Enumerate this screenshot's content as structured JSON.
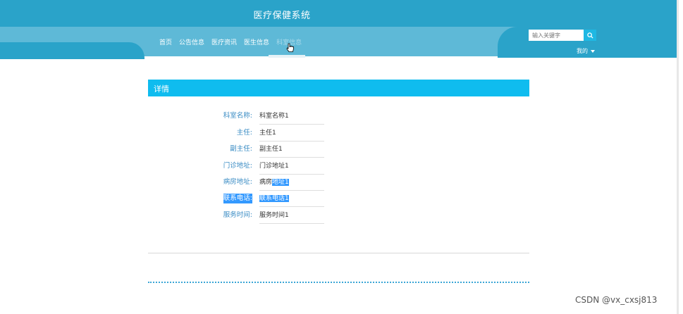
{
  "app": {
    "title": "医疗保健系统"
  },
  "nav": {
    "items": [
      {
        "label": "首页",
        "dim": false
      },
      {
        "label": "公告信息",
        "dim": false
      },
      {
        "label": "医疗资讯",
        "dim": false
      },
      {
        "label": "医生信息",
        "dim": false
      },
      {
        "label": "科室信息",
        "dim": true
      }
    ]
  },
  "search": {
    "placeholder": "输入关键字",
    "icon": "search-icon"
  },
  "user": {
    "label": "我的",
    "icon": "caret-down-icon"
  },
  "card": {
    "title": "详情"
  },
  "detail": {
    "fields": [
      {
        "label": "科室名称:",
        "value": "科室名称1"
      },
      {
        "label": "主任:",
        "value": "主任1"
      },
      {
        "label": "副主任:",
        "value": "副主任1"
      },
      {
        "label": "门诊地址:",
        "value": "门诊地址1"
      },
      {
        "label": "病房地址:",
        "value_plain": "病房",
        "value_selected": "地址1"
      },
      {
        "label": "联系电话:",
        "value": "联系电话1"
      },
      {
        "label": "服务时间:",
        "value": "服务时间1"
      }
    ]
  },
  "watermark": "CSDN @vx_cxsj813",
  "colors": {
    "header": "#2aa3c9",
    "nav_band": "#5eb9d7",
    "card_header": "#0fbcef",
    "label": "#3a8cc4",
    "selection": "#3399ff"
  }
}
